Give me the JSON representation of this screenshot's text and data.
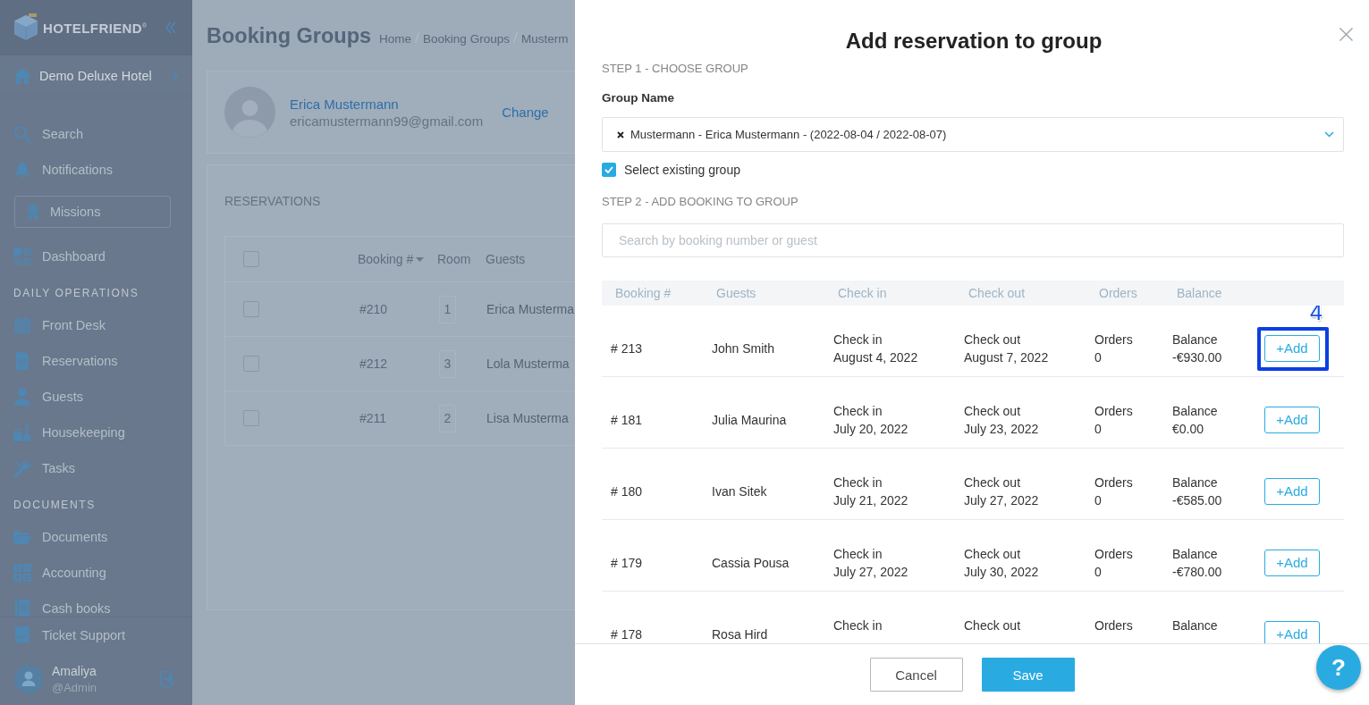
{
  "sidebar": {
    "brand": "HOTELFRIEND$^{®}$",
    "hotel": "Demo Deluxe Hotel",
    "items": [
      {
        "kind": "link",
        "label": "Search"
      },
      {
        "kind": "link",
        "label": "Notifications"
      },
      {
        "kind": "boxed",
        "label": "Missions"
      },
      {
        "kind": "link",
        "label": "Dashboard"
      }
    ],
    "sections": [
      {
        "title": "DAILY OPERATIONS",
        "items": [
          "Front Desk",
          "Reservations",
          "Guests",
          "Housekeeping",
          "Tasks"
        ]
      },
      {
        "title": "DOCUMENTS",
        "items": [
          "Documents",
          "Accounting",
          "Cash books"
        ]
      }
    ],
    "support": "Ticket Support",
    "user": {
      "name": "Amaliya",
      "handle": "@Admin"
    }
  },
  "page": {
    "title": "Booking Groups",
    "breadcrumb": [
      "Home",
      "Booking Groups",
      "Musterm"
    ],
    "guest": {
      "name": "Erica Mustermann",
      "email": "ericamustermann99@gmail.com",
      "action": "Change"
    },
    "reservations": {
      "title": "RESERVATIONS",
      "all_checked": false,
      "columns": [
        {
          "label": "Booking #",
          "sorted": true
        },
        {
          "label": "Room",
          "sorted": false
        },
        {
          "label": "Guests",
          "sorted": false
        }
      ],
      "rows": [
        {
          "checked": false,
          "booking": "#210",
          "room": "1",
          "guest": "Erica Musterma"
        },
        {
          "checked": false,
          "booking": "#212",
          "room": "3",
          "guest": "Lola Musterma"
        },
        {
          "checked": false,
          "booking": "#211",
          "room": "2",
          "guest": "Lisa Musterma"
        }
      ]
    }
  },
  "modal": {
    "title": "Add reservation to group",
    "step1": "STEP 1 - CHOOSE GROUP",
    "group": {
      "label": "Group Name",
      "value": "Mustermann - Erica Mustermann - (2022-08-04 / 2022-08-07)"
    },
    "existing_group": {
      "label": "Select existing group",
      "checked": true
    },
    "step2": "STEP 2 - ADD BOOKING TO GROUP",
    "search": {
      "placeholder": "Search by booking number or guest"
    },
    "table": {
      "columns": [
        "Booking #",
        "Guests",
        "Check in",
        "Check out",
        "Orders",
        "Balance"
      ],
      "rows": [
        {
          "booking": "# 213",
          "guest": "John Smith",
          "check_in": {
            "label": "Check in",
            "value": "August 4, 2022"
          },
          "check_out": {
            "label": "Check out",
            "value": "August 7, 2022"
          },
          "orders": {
            "label": "Orders",
            "value": "0"
          },
          "balance": {
            "label": "Balance",
            "value": "-€930.00"
          },
          "action": "+Add",
          "callout": "4"
        },
        {
          "booking": "# 181",
          "guest": "Julia Maurina",
          "check_in": {
            "label": "Check in",
            "value": "July 20, 2022"
          },
          "check_out": {
            "label": "Check out",
            "value": "July 23, 2022"
          },
          "orders": {
            "label": "Orders",
            "value": "0"
          },
          "balance": {
            "label": "Balance",
            "value": "€0.00"
          },
          "action": "+Add"
        },
        {
          "booking": "# 180",
          "guest": "Ivan Sitek",
          "check_in": {
            "label": "Check in",
            "value": "July 21, 2022"
          },
          "check_out": {
            "label": "Check out",
            "value": "July 27, 2022"
          },
          "orders": {
            "label": "Orders",
            "value": "0"
          },
          "balance": {
            "label": "Balance",
            "value": "-€585.00"
          },
          "action": "+Add"
        },
        {
          "booking": "# 179",
          "guest": "Cassia Pousa",
          "check_in": {
            "label": "Check in",
            "value": "July 27, 2022"
          },
          "check_out": {
            "label": "Check out",
            "value": "July 30, 2022"
          },
          "orders": {
            "label": "Orders",
            "value": "0"
          },
          "balance": {
            "label": "Balance",
            "value": "-€780.00"
          },
          "action": "+Add"
        },
        {
          "booking": "# 178",
          "guest": "Rosa Hird",
          "check_in": {
            "label": "Check in"
          },
          "check_out": {
            "label": "Check out"
          },
          "orders": {
            "label": "Orders"
          },
          "balance": {
            "label": "Balance"
          },
          "action": "+Add"
        }
      ]
    },
    "buttons": [
      {
        "kind": "secondary",
        "label": "Cancel"
      },
      {
        "kind": "primary",
        "label": "Save"
      }
    ]
  },
  "help": {
    "label": "?"
  }
}
